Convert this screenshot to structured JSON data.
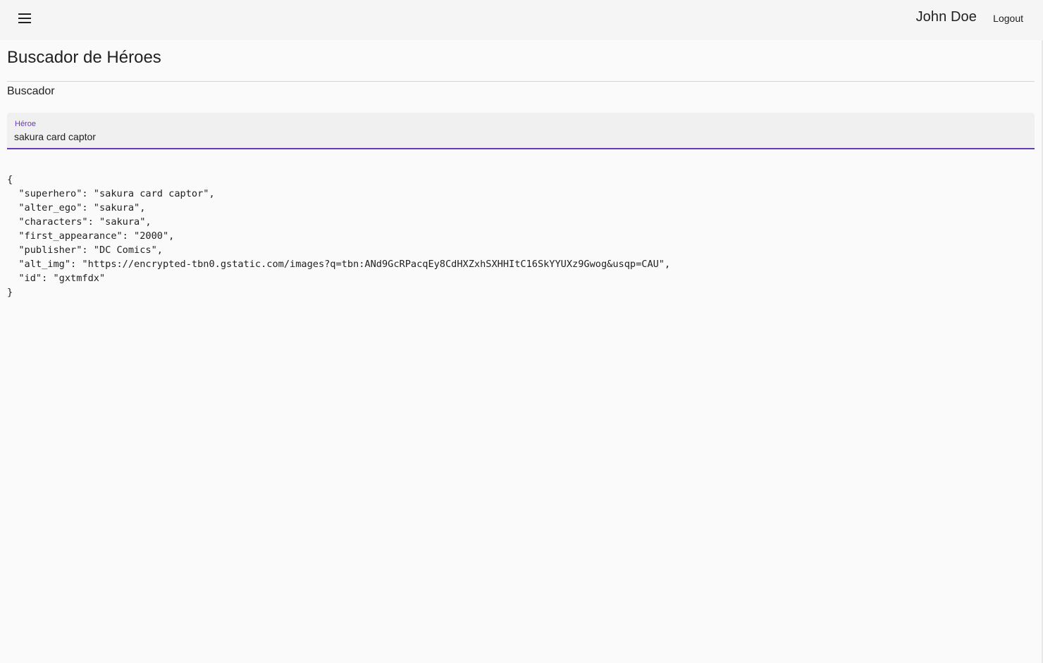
{
  "header": {
    "menu_icon": "hamburger-menu-icon",
    "user_name": "John Doe",
    "logout_label": "Logout"
  },
  "page": {
    "title": "Buscador de Héroes",
    "section_label": "Buscador"
  },
  "search": {
    "label": "Héroe",
    "value": "sakura card captor"
  },
  "result": {
    "json_text": "{\n  \"superhero\": \"sakura card captor\",\n  \"alter_ego\": \"sakura\",\n  \"characters\": \"sakura\",\n  \"first_appearance\": \"2000\",\n  \"publisher\": \"DC Comics\",\n  \"alt_img\": \"https://encrypted-tbn0.gstatic.com/images?q=tbn:ANd9GcRPacqEy8CdHXZxhSXHHItC16SkYYUXz9Gwog&usqp=CAU\",\n  \"id\": \"gxtmfdx\"\n}"
  },
  "colors": {
    "accent": "#673ab7",
    "toolbar_bg": "#f5f5f5",
    "page_bg": "#fafafa"
  }
}
